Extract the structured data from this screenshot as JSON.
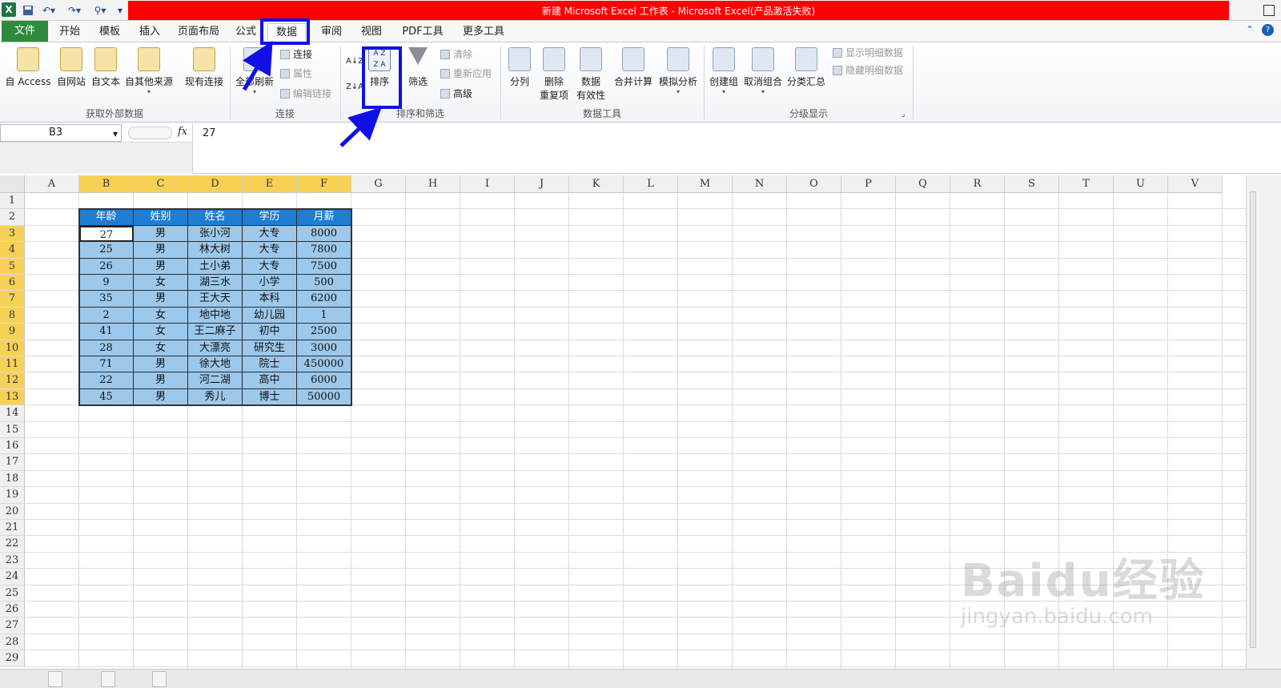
{
  "window": {
    "title": "新建 Microsoft Excel 工作表 - Microsoft Excel(产品激活失败)"
  },
  "menu": {
    "tabs": [
      "文件",
      "开始",
      "模板",
      "插入",
      "页面布局",
      "公式",
      "数据",
      "审阅",
      "视图",
      "PDF工具",
      "更多工具"
    ],
    "active": "数据"
  },
  "ribbon": {
    "external": {
      "label": "获取外部数据",
      "buttons": [
        "自 Access",
        "自网站",
        "自文本",
        "自其他来源",
        "现有连接"
      ]
    },
    "connections": {
      "label": "连接",
      "refresh_all": "全部刷新",
      "items": [
        "连接",
        "属性",
        "编辑链接"
      ]
    },
    "sort_filter": {
      "label": "排序和筛选",
      "sort": "排序",
      "filter": "筛选",
      "items": [
        "清除",
        "重新应用",
        "高级"
      ]
    },
    "data_tools": {
      "label": "数据工具",
      "split": "分列",
      "remove_dup_1": "删除",
      "remove_dup_2": "重复项",
      "validation_1": "数据",
      "validation_2": "有效性",
      "consolidate": "合并计算",
      "whatif": "模拟分析"
    },
    "outline": {
      "label": "分级显示",
      "group": "创建组",
      "ungroup": "取消组合",
      "subtotal": "分类汇总",
      "show_detail": "显示明细数据",
      "hide_detail": "隐藏明细数据"
    }
  },
  "formula_bar": {
    "name_box": "B3",
    "fx_label": "fx",
    "value": "27"
  },
  "columns": [
    "A",
    "B",
    "C",
    "D",
    "E",
    "F",
    "G",
    "H",
    "I",
    "J",
    "K",
    "L",
    "M",
    "N",
    "O",
    "P",
    "Q",
    "R",
    "S",
    "T",
    "U",
    "V"
  ],
  "rows": [
    "1",
    "2",
    "3",
    "4",
    "5",
    "6",
    "7",
    "8",
    "9",
    "10",
    "11",
    "12",
    "13",
    "14",
    "15",
    "16",
    "17",
    "18",
    "19",
    "20",
    "21",
    "22",
    "23",
    "24",
    "25",
    "26",
    "27",
    "28",
    "29"
  ],
  "table": {
    "headers": [
      "年龄",
      "姓别",
      "姓名",
      "学历",
      "月薪"
    ],
    "rows": [
      [
        "27",
        "男",
        "张小河",
        "大专",
        "8000"
      ],
      [
        "25",
        "男",
        "林大树",
        "大专",
        "7800"
      ],
      [
        "26",
        "男",
        "土小弟",
        "大专",
        "7500"
      ],
      [
        "9",
        "女",
        "湖三水",
        "小学",
        "500"
      ],
      [
        "35",
        "男",
        "王大天",
        "本科",
        "6200"
      ],
      [
        "2",
        "女",
        "地中地",
        "幼儿园",
        "1"
      ],
      [
        "41",
        "女",
        "王二麻子",
        "初中",
        "2500"
      ],
      [
        "28",
        "女",
        "大漂亮",
        "研究生",
        "3000"
      ],
      [
        "71",
        "男",
        "徐大地",
        "院士",
        "450000"
      ],
      [
        "22",
        "男",
        "河二湖",
        "高中",
        "6000"
      ],
      [
        "45",
        "男",
        "秀儿",
        "博士",
        "50000"
      ]
    ]
  },
  "watermark": {
    "brand": "Baidu经验",
    "url": "jingyan.baidu.com"
  },
  "colors": {
    "title_band": "#ff0000",
    "header_fill": "#1f7dd4",
    "body_fill": "#9cc8eb",
    "selection_header": "#f7d156",
    "annotation": "#1010e6"
  }
}
